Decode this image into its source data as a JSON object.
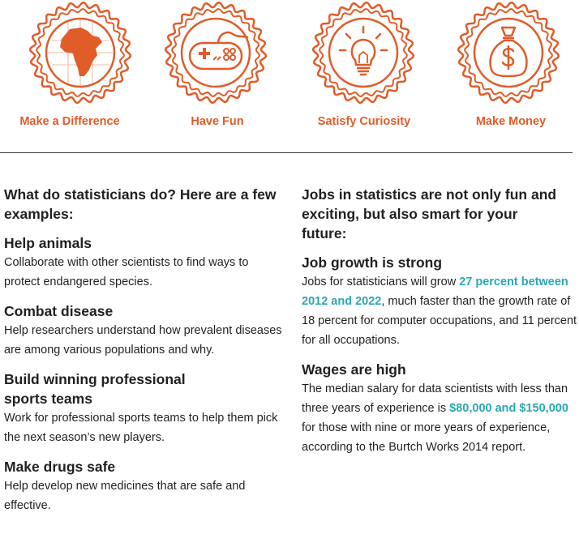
{
  "badges": [
    {
      "label": "Make a Difference",
      "icon": "africa-globe-icon"
    },
    {
      "label": "Have Fun",
      "icon": "game-controller-icon"
    },
    {
      "label": "Satisfy Curiosity",
      "icon": "lightbulb-icon"
    },
    {
      "label": "Make Money",
      "icon": "money-bag-icon"
    }
  ],
  "colors": {
    "accent": "#e05c28",
    "highlight": "#2aa7b3",
    "text": "#231f20"
  },
  "left": {
    "intro": "What do statisticians do? Here are a few examples:",
    "items": [
      {
        "heading": "Help animals",
        "text": "Collaborate with other scientists to find ways to protect endangered species."
      },
      {
        "heading": "Combat disease",
        "text": "Help researchers understand how prevalent diseases are among various populations and why."
      },
      {
        "heading": "Build winning professional sports teams",
        "text": "Work for professional sports teams to help them pick the next season’s new players."
      },
      {
        "heading": "Make drugs safe",
        "text": "Help develop new medicines that are safe and effective."
      }
    ]
  },
  "right": {
    "intro": "Jobs in statistics are not only fun and exciting, but also smart for your future:",
    "growth": {
      "heading": "Job growth is strong",
      "before": "Jobs for statisticians will grow ",
      "highlight": "27 percent between 2012 and 2022",
      "after": ", much faster than the growth rate of 18 percent for computer occupations, and 11 percent for all occupations."
    },
    "wages": {
      "heading": "Wages are high",
      "before": "The median salary for data scientists with less than three years of experience is ",
      "highlight": "$80,000 and $150,000",
      "after": " for those with nine or more years of experience, according to the Burtch Works 2014 report."
    }
  }
}
